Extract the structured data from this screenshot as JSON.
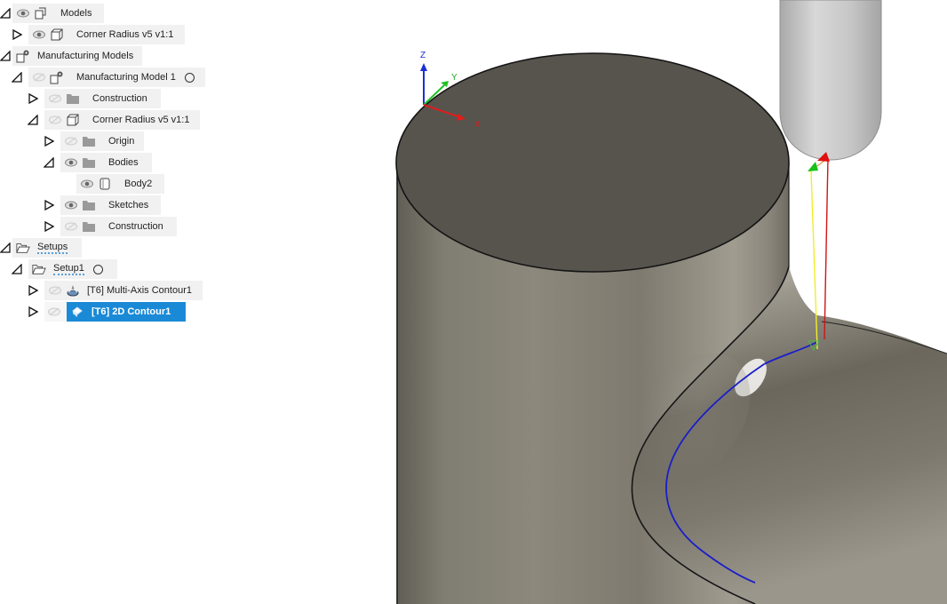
{
  "browser": {
    "items": [
      {
        "label": "Models"
      },
      {
        "label": "Corner Radius v5 v1:1"
      },
      {
        "label": "Manufacturing Models"
      },
      {
        "label": "Manufacturing Model 1"
      },
      {
        "label": "Construction"
      },
      {
        "label": "Corner Radius v5 v1:1"
      },
      {
        "label": "Origin"
      },
      {
        "label": "Bodies"
      },
      {
        "label": "Body2"
      },
      {
        "label": "Sketches"
      },
      {
        "label": "Construction"
      },
      {
        "label": "Setups"
      },
      {
        "label": "Setup1"
      },
      {
        "label": "[T6] Multi-Axis Contour1"
      },
      {
        "label": "[T6] 2D Contour1"
      }
    ]
  },
  "viewport": {
    "axes": {
      "z": "Z",
      "y": "Y",
      "x": "X"
    }
  }
}
